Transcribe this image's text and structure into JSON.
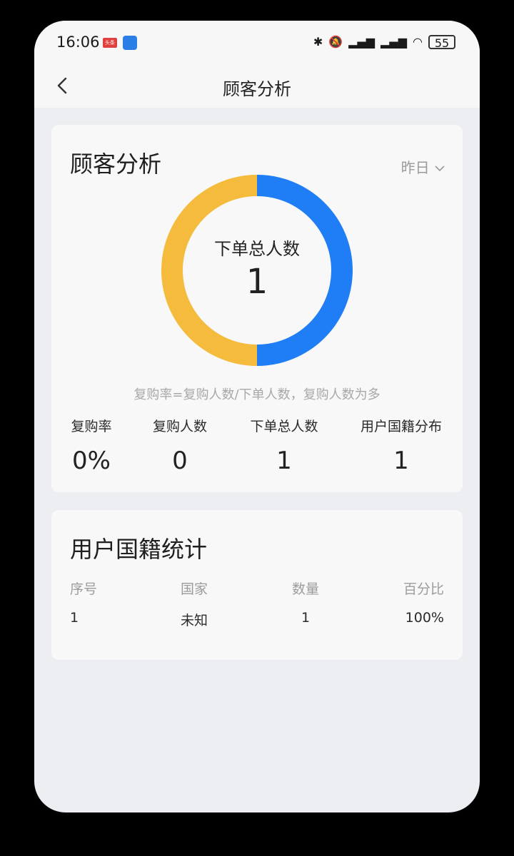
{
  "status_bar": {
    "time": "16:06",
    "app_badge_1": "头条",
    "battery": "55",
    "icons": [
      "bluetooth-icon",
      "mute-icon",
      "hd-signal-icon",
      "hd-signal-icon",
      "wifi-icon",
      "battery-icon"
    ]
  },
  "nav": {
    "back_icon": "chevron-left-icon",
    "title": "顾客分析"
  },
  "analysis": {
    "title": "顾客分析",
    "period": "昨日",
    "period_icon": "chevron-down-icon",
    "donut_label": "下单总人数",
    "donut_value": "1",
    "formula": "复购率=复购人数/下单人数，复购人数为多",
    "metrics": [
      {
        "label": "复购率",
        "value": "0%"
      },
      {
        "label": "复购人数",
        "value": "0"
      },
      {
        "label": "下单总人数",
        "value": "1"
      },
      {
        "label": "用户国籍分布",
        "value": "1"
      }
    ]
  },
  "chart_data": {
    "type": "pie",
    "categories": [
      "blue-segment",
      "yellow-segment"
    ],
    "values": [
      50,
      50
    ],
    "colors": [
      "#1f7ef5",
      "#f4bb3c"
    ]
  },
  "nationality": {
    "title": "用户国籍统计",
    "columns": [
      "序号",
      "国家",
      "数量",
      "百分比"
    ],
    "rows": [
      [
        "1",
        "未知",
        "1",
        "100%"
      ]
    ]
  },
  "colors": {
    "page_bg": "#eceef2",
    "card_bg": "#f8f8f9",
    "accent_blue": "#1f7ef5",
    "accent_yellow": "#f4bb3c"
  }
}
